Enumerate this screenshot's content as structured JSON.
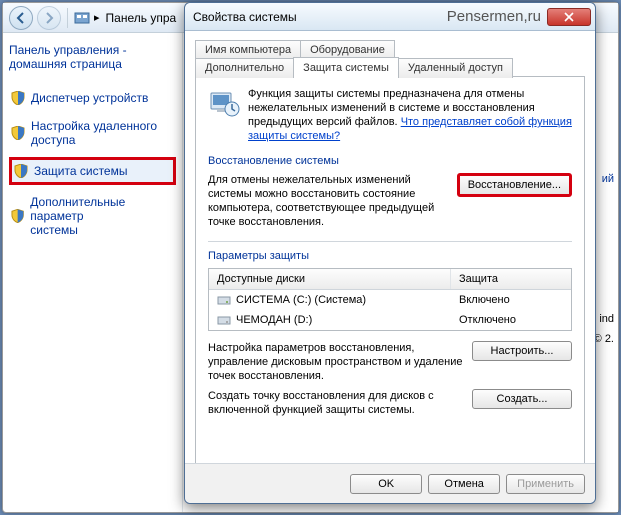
{
  "cp": {
    "breadcrumb": "Панель упра",
    "home_line1": "Панель управления -",
    "home_line2": "домашняя страница",
    "links": {
      "devmgr": "Диспетчер устройств",
      "remote1": "Настройка удаленного",
      "remote2": "доступа",
      "protect": "Защита системы",
      "adv1": "Дополнительные параметр",
      "adv2": "системы"
    },
    "edge1": "ий",
    "edge2": "ind",
    "edge3": "© 2."
  },
  "dlg": {
    "title": "Свойства системы",
    "watermark": "Pensermen,ru",
    "tabs": {
      "t1": "Имя компьютера",
      "t2": "Оборудование",
      "t3": "Дополнительно",
      "t4": "Защита системы",
      "t5": "Удаленный доступ"
    },
    "intro": "Функция защиты системы предназначена для отмены нежелательных изменений в системе и восстановления предыдущих версий файлов. ",
    "intro_link": "Что представляет собой функция защиты системы?",
    "sect_restore": "Восстановление системы",
    "restore_text": "Для отмены нежелательных изменений системы можно восстановить состояние компьютера, соответствующее предыдущей точке восстановления.",
    "btn_restore": "Восстановление...",
    "sect_params": "Параметры защиты",
    "col1": "Доступные диски",
    "col2": "Защита",
    "drives": [
      {
        "name": "СИСТЕМА (C:) (Система)",
        "status": "Включено"
      },
      {
        "name": "ЧЕМОДАН (D:)",
        "status": "Отключено"
      }
    ],
    "cfg_text": "Настройка параметров восстановления, управление дисковым пространством и удаление точек восстановления.",
    "btn_cfg": "Настроить...",
    "create_text": "Создать точку восстановления для дисков с включенной функцией защиты системы.",
    "btn_create": "Создать...",
    "btn_ok": "OK",
    "btn_cancel": "Отмена",
    "btn_apply": "Применить"
  }
}
